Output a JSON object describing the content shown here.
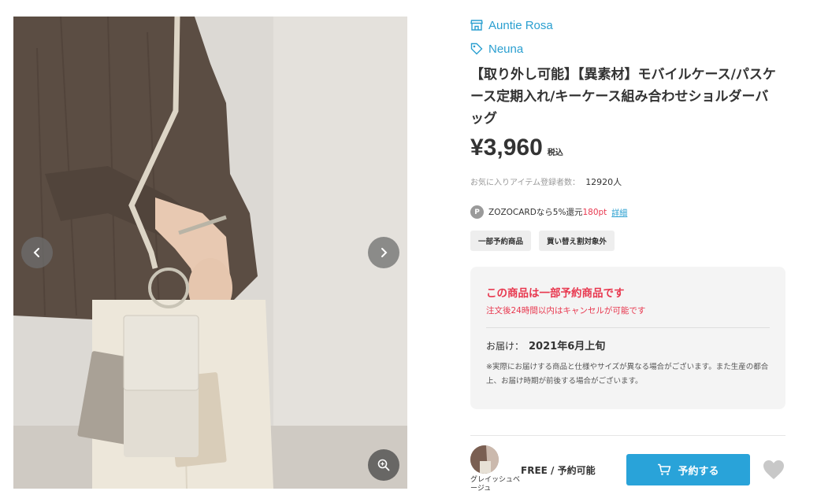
{
  "gallery": {
    "prev_icon": "chevron-left-icon",
    "next_icon": "chevron-right-icon",
    "zoom_icon": "zoom-in-icon"
  },
  "brand": {
    "shop_name": "Auntie Rosa",
    "shop_icon": "store-icon",
    "brand_name": "Neuna",
    "brand_icon": "tag-icon"
  },
  "product": {
    "title": "【取り外し可能】【異素材】モバイルケース/パスケース定期入れ/キーケース組み合わせショルダーバッグ",
    "price": "¥3,960",
    "tax_label": "税込",
    "favorite_label": "お気に入りアイテム登録者数：",
    "favorite_count": "12920人"
  },
  "points": {
    "badge": "P",
    "text": "ZOZOCARDなら5%還元",
    "points": "180pt",
    "detail_link": "詳細"
  },
  "tags": [
    "一部予約商品",
    "買い替え割対象外"
  ],
  "notice": {
    "heading": "この商品は一部予約商品です",
    "subtext": "注文後24時間以内はキャンセルが可能です",
    "delivery_label": "お届け：",
    "delivery_date": "2021年6月上旬",
    "note": "※実際にお届けする商品と仕様やサイズが異なる場合がございます。また生産の都合上、お届け時期が前後する場合がございます。"
  },
  "sku": {
    "color_name": "グレイッシュベージュ",
    "size_status": "FREE / 予約可能",
    "reserve_label": "予約する",
    "cart_icon": "cart-icon",
    "favorite_icon": "heart-icon"
  },
  "colors": {
    "accent": "#29a3d9",
    "link": "#2a9fd0",
    "alert": "#e8384f",
    "notice_bg": "#f4f4f4"
  }
}
